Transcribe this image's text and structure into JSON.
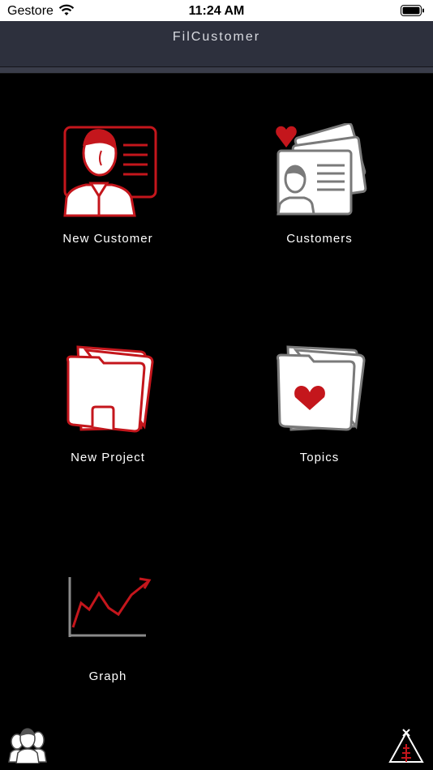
{
  "status_bar": {
    "carrier": "Gestore",
    "time": "11:24 AM"
  },
  "nav": {
    "title": "FilCustomer"
  },
  "menu": {
    "new_customer": "New Customer",
    "customers": "Customers",
    "new_project": "New Project",
    "topics": "Topics",
    "graph": "Graph"
  },
  "colors": {
    "accent": "#c4161c",
    "gray": "#7a7a7a",
    "nav_bg": "#2d303d"
  },
  "icons": {
    "new_customer": "customer-card-icon",
    "customers": "customers-cards-heart-icon",
    "new_project": "folder-icon",
    "topics": "folder-heart-icon",
    "graph": "line-chart-icon",
    "bottom_left": "team-icon",
    "bottom_right": "tent-logo-icon"
  }
}
